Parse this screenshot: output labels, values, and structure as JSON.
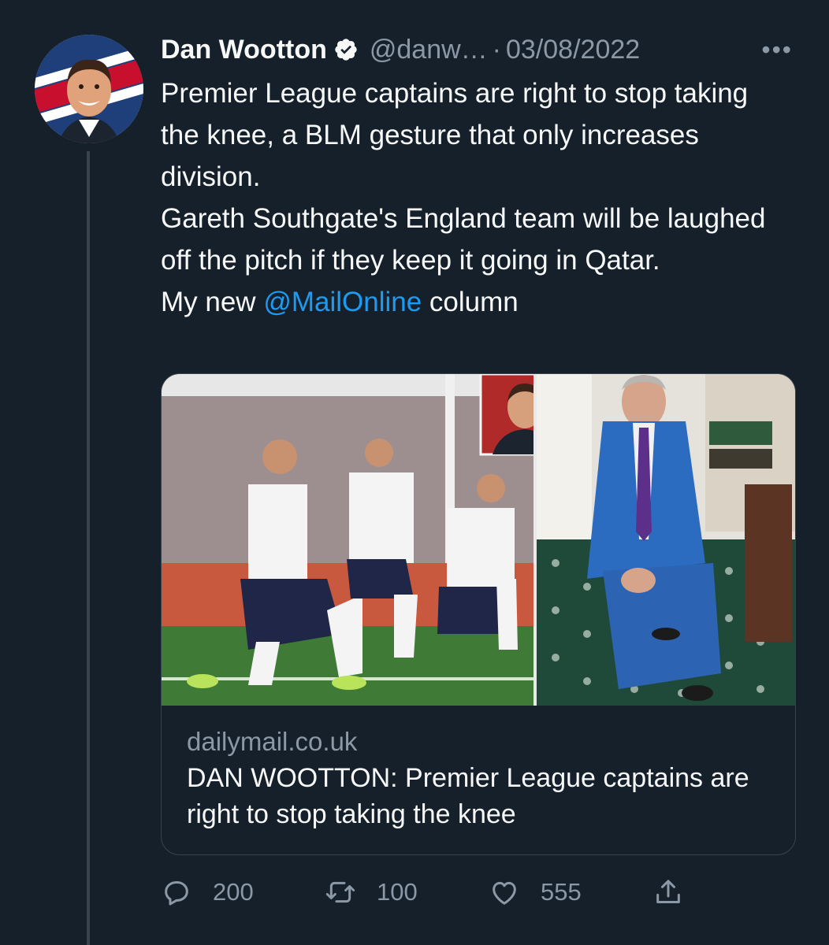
{
  "tweet": {
    "author_name": "Dan Wootton",
    "handle": "@danw…",
    "separator": "·",
    "date": "03/08/2022",
    "more_label": "•••",
    "text_lines": {
      "l1": "Premier League captains are right to stop taking the knee, a BLM gesture that only increases division.",
      "l2": "Gareth Southgate's England team will be laughed off the pitch if they keep it going in Qatar.",
      "l3_prefix": "My new ",
      "l3_mention": "@MailOnline",
      "l3_suffix": " column"
    },
    "card": {
      "domain": "dailymail.co.uk",
      "title": "DAN WOOTTON: Premier League captains are right to stop taking the knee"
    },
    "actions": {
      "replies": "200",
      "retweets": "100",
      "likes": "555"
    }
  },
  "colors": {
    "background": "#15202b",
    "text": "#f7f9f9",
    "secondary": "#8b98a5",
    "link": "#1d9bf0",
    "border": "#38444d"
  },
  "icons": [
    "verified-badge-icon",
    "more-icon",
    "reply-icon",
    "retweet-icon",
    "like-icon",
    "share-icon"
  ]
}
